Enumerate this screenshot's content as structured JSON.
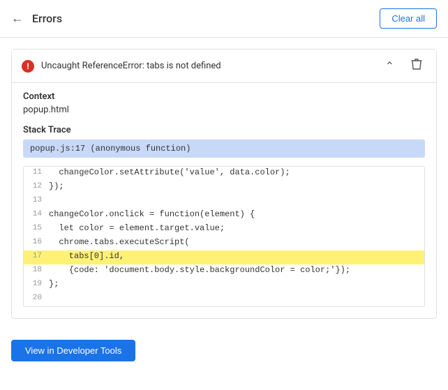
{
  "header": {
    "title": "Errors",
    "clear_all_label": "Clear all",
    "back_icon": "←"
  },
  "error": {
    "title": "Uncaught ReferenceError: tabs is not defined",
    "icon_label": "!",
    "context_label": "Context",
    "context_value": "popup.html",
    "stack_trace_label": "Stack Trace",
    "stack_trace_value": "popup.js:17 (anonymous function)"
  },
  "code": {
    "lines": [
      {
        "num": "11",
        "text": "  changeColor.setAttribute('value', data.color);",
        "highlight": false
      },
      {
        "num": "12",
        "text": "});",
        "highlight": false
      },
      {
        "num": "13",
        "text": "",
        "highlight": false
      },
      {
        "num": "14",
        "text": "changeColor.onclick = function(element) {",
        "highlight": false
      },
      {
        "num": "15",
        "text": "  let color = element.target.value;",
        "highlight": false
      },
      {
        "num": "16",
        "text": "  chrome.tabs.executeScript(",
        "highlight": false
      },
      {
        "num": "17",
        "text": "    tabs[0].id,",
        "highlight": true
      },
      {
        "num": "18",
        "text": "    {code: 'document.body.style.backgroundColor = color;'});",
        "highlight": false
      },
      {
        "num": "19",
        "text": "};",
        "highlight": false
      },
      {
        "num": "20",
        "text": "",
        "highlight": false
      }
    ]
  },
  "footer": {
    "view_btn_label": "View in Developer Tools"
  }
}
